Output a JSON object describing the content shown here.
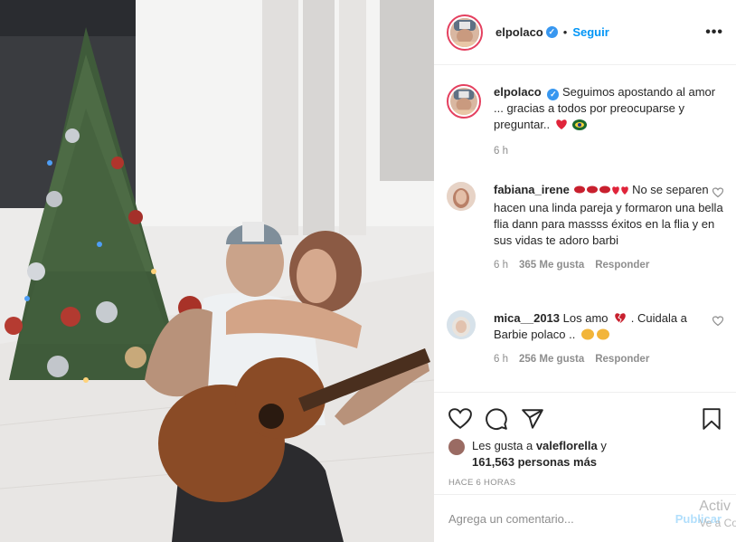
{
  "post": {
    "username": "elpolaco",
    "follow_label": "Seguir",
    "separator": "•",
    "more_label": "•••",
    "caption": "Seguimos apostando al amor ... gracias a todos por preocuparse y preguntar..",
    "caption_time": "6 h"
  },
  "comments": [
    {
      "username": "fabiana_irene",
      "text": "No se separen hacen una linda pareja y formaron una bella flia dann para massss éxitos en la flia y en sus vidas te adoro barbi",
      "time": "6 h",
      "likes": "365 Me gusta",
      "reply": "Responder"
    },
    {
      "username": "mica__2013",
      "text": "Los amo",
      "text2": ". Cuidala a Barbie polaco ..",
      "time": "6 h",
      "likes": "256 Me gusta",
      "reply": "Responder"
    }
  ],
  "likes": {
    "prefix": "Les gusta a ",
    "user": "valeflorella",
    "mid": " y",
    "count": "161,563 personas más"
  },
  "timestamp": "HACE 6 HORAS",
  "add_comment": {
    "placeholder": "Agrega un comentario...",
    "publish": "Publicar"
  },
  "watermark": {
    "line1": "Activ",
    "line2": "Ve a Co"
  },
  "colors": {
    "accent": "#0095f6",
    "verified": "#3897f0",
    "heart": "#ed4956",
    "muted": "#8e8e8e"
  },
  "icons": [
    "verified-badge",
    "heart-icon",
    "comment-icon",
    "share-icon",
    "bookmark-icon",
    "more-icon"
  ]
}
